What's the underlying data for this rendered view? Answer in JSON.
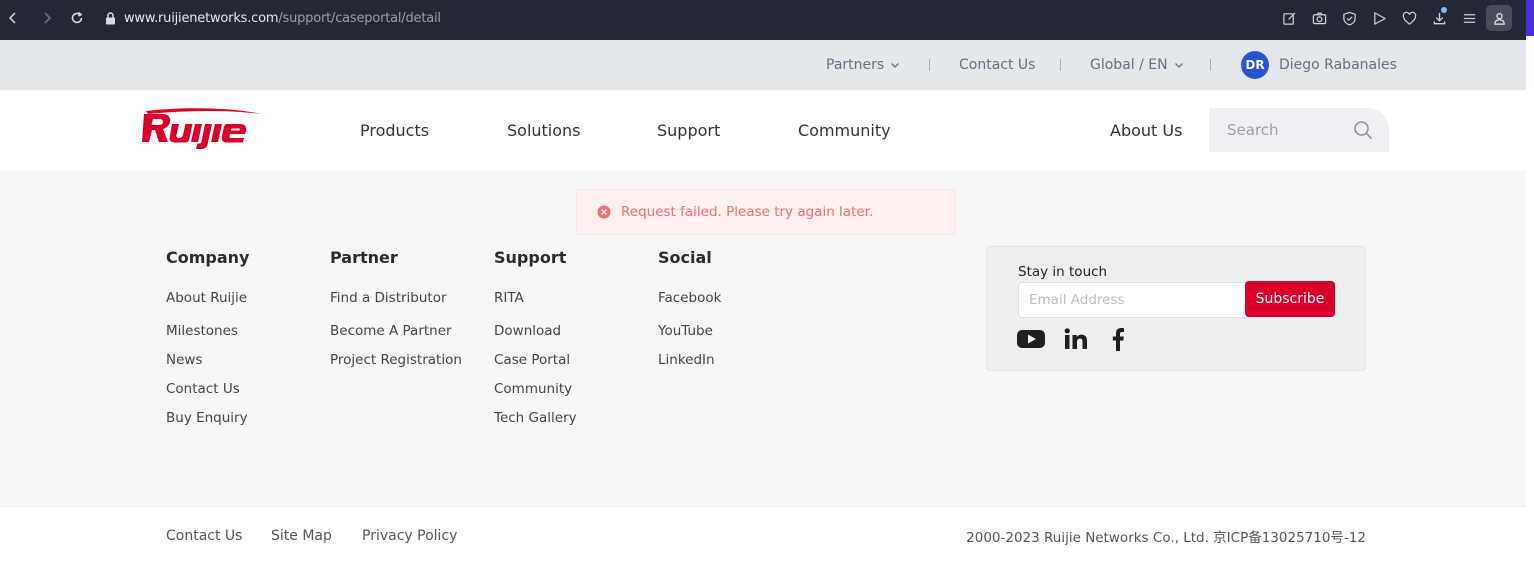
{
  "browser": {
    "url_host": "www.ruijienetworks.com",
    "url_path": "/support/caseportal/detail"
  },
  "util_bar": {
    "partners": "Partners",
    "contact": "Contact Us",
    "language": "Global / EN",
    "avatar_initials": "DR",
    "user_name": "Diego Rabanales"
  },
  "header": {
    "logo_text": "Ruijie",
    "nav": [
      "Products",
      "Solutions",
      "Support",
      "Community"
    ],
    "about": "About Us",
    "search_placeholder": "Search"
  },
  "toast": {
    "message": "Request failed. Please try again later."
  },
  "footer": {
    "columns": [
      {
        "title": "Company",
        "links": [
          "About Ruijie",
          "Milestones",
          "News",
          "Contact Us",
          "Buy Enquiry"
        ]
      },
      {
        "title": "Partner",
        "links": [
          "Find a Distributor",
          "Become A Partner",
          "Project Registration"
        ]
      },
      {
        "title": "Support",
        "links": [
          "RITA",
          "Download",
          "Case Portal",
          "Community",
          "Tech Gallery"
        ]
      },
      {
        "title": "Social",
        "links": [
          "Facebook",
          "YouTube",
          "LinkedIn"
        ]
      }
    ],
    "subscribe": {
      "heading": "Stay in touch",
      "placeholder": "Email Address",
      "button": "Subscribe",
      "social_icons": [
        "youtube-icon",
        "linkedin-icon",
        "facebook-icon"
      ]
    },
    "bottom": {
      "links": [
        "Contact Us",
        "Site Map",
        "Privacy Policy"
      ],
      "copyright": "2000-2023 Ruijie Networks Co., Ltd. 京ICP备13025710号-12"
    }
  },
  "colors": {
    "brand_red": "#d8002b",
    "error_text": "#f56c6c",
    "avatar_blue": "#2a53cf"
  }
}
